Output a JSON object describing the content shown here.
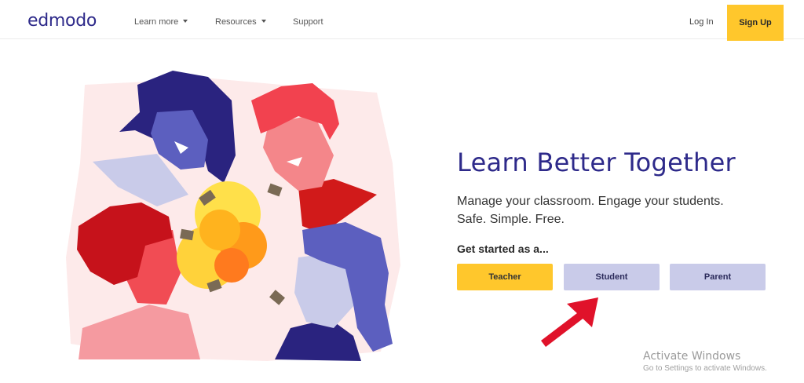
{
  "header": {
    "logo": "edmodo",
    "nav": [
      {
        "label": "Learn more"
      },
      {
        "label": "Resources"
      },
      {
        "label": "Support"
      }
    ],
    "login_label": "Log In",
    "signup_label": "Sign Up"
  },
  "hero": {
    "headline": "Learn Better Together",
    "subline1": "Manage your classroom. Engage your students.",
    "subline2": "Safe. Simple. Free.",
    "get_started": "Get started as a...",
    "roles": {
      "teacher": "Teacher",
      "student": "Student",
      "parent": "Parent"
    }
  },
  "watermark": {
    "title": "Activate Windows",
    "subtitle": "Go to Settings to activate Windows."
  },
  "colors": {
    "brand": "#2e2a8a",
    "accent_yellow": "#ffc72c",
    "role_lavender": "#c9cbe9",
    "arrow_red": "#e0122a"
  }
}
